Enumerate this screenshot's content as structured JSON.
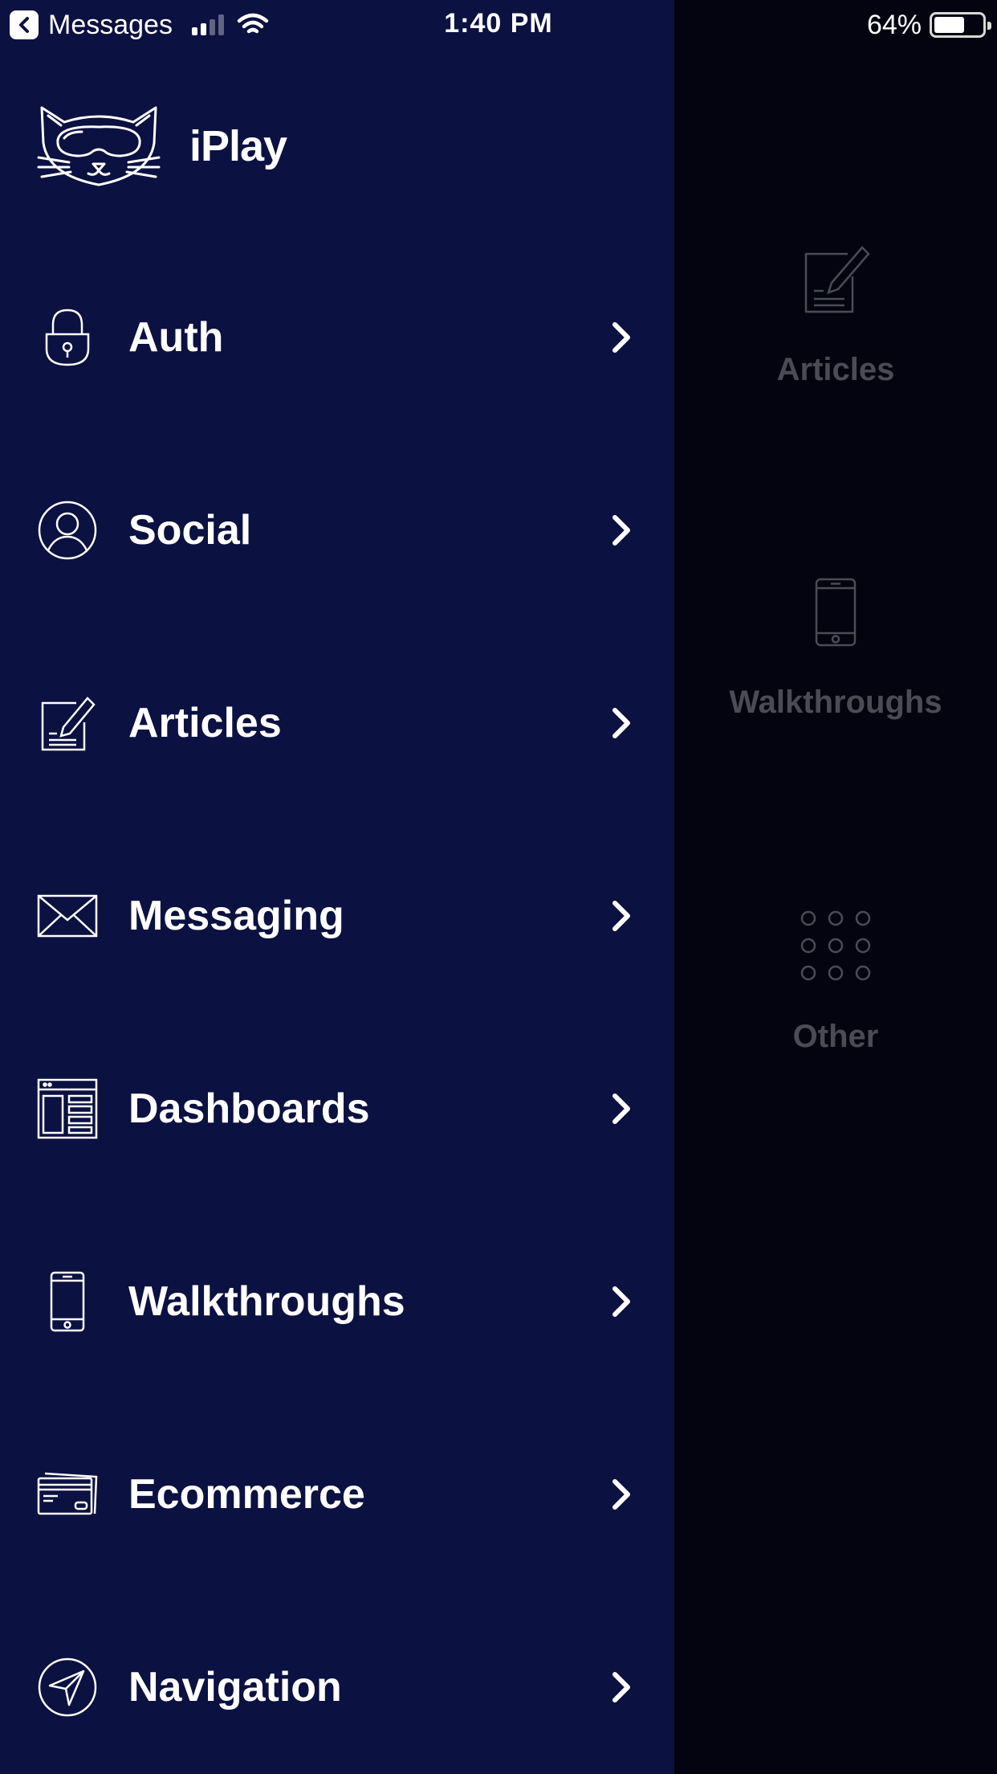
{
  "status_bar": {
    "back_label": "Messages",
    "time": "1:40 PM",
    "battery_percent": "64%",
    "battery_level": 0.64,
    "signal_bars": 2,
    "icons": [
      "back-arrow-icon",
      "signal-icon",
      "wifi-icon",
      "battery-icon"
    ]
  },
  "drawer": {
    "brand_name": "iPlay",
    "brand_logo": "cat-mask-logo",
    "background_color": "#0b1140",
    "items": [
      {
        "label": "Auth",
        "icon": "padlock-icon"
      },
      {
        "label": "Social",
        "icon": "user-circle-icon"
      },
      {
        "label": "Articles",
        "icon": "document-pencil-icon"
      },
      {
        "label": "Messaging",
        "icon": "envelope-icon"
      },
      {
        "label": "Dashboards",
        "icon": "dashboard-window-icon"
      },
      {
        "label": "Walkthroughs",
        "icon": "smartphone-icon"
      },
      {
        "label": "Ecommerce",
        "icon": "credit-card-icon"
      },
      {
        "label": "Navigation",
        "icon": "navigation-arrow-icon"
      }
    ]
  },
  "background_screen": {
    "tiles": [
      {
        "label": "Articles",
        "icon": "document-pencil-icon"
      },
      {
        "label": "Walkthroughs",
        "icon": "smartphone-icon"
      },
      {
        "label": "Other",
        "icon": "grid-dots-icon"
      }
    ]
  }
}
